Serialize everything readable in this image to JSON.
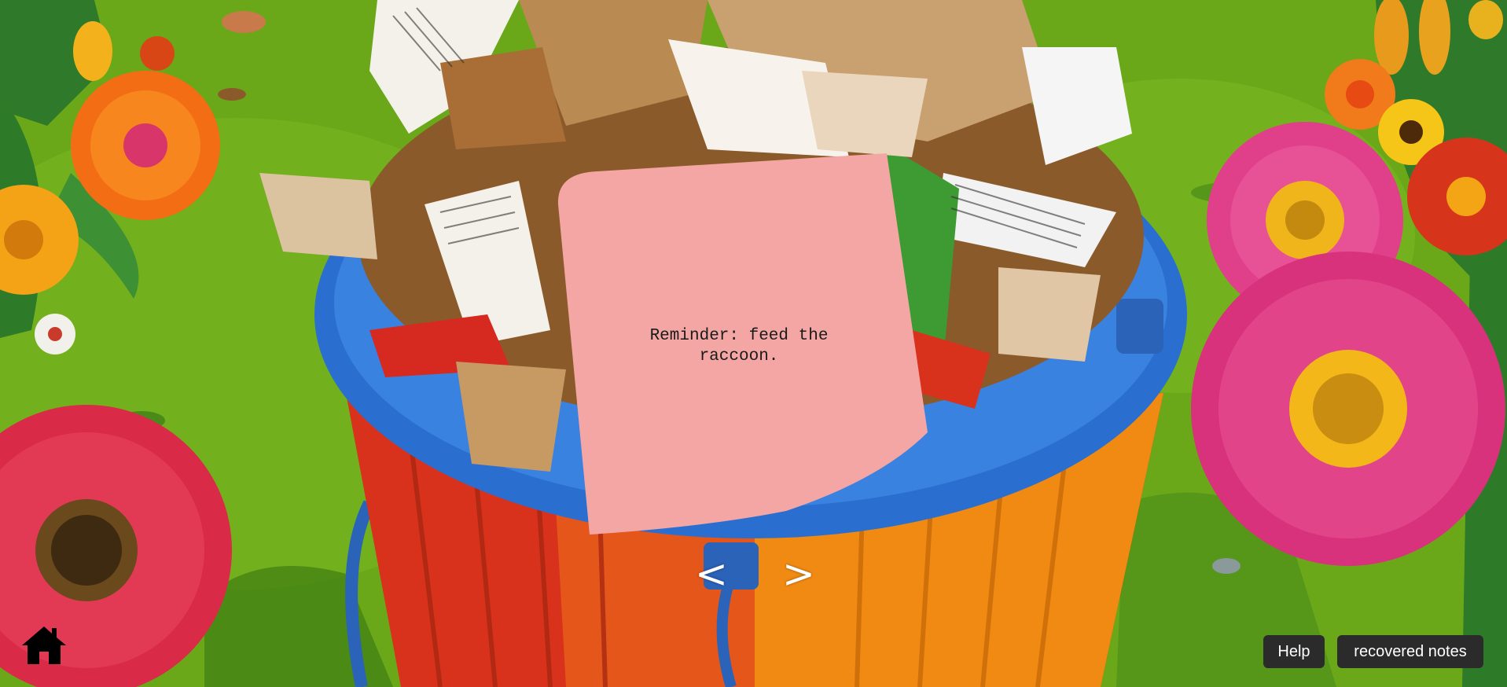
{
  "note": {
    "text": "Reminder: feed the raccoon.",
    "color": "#f4a6a4"
  },
  "navigation": {
    "prev_label": "<",
    "next_label": ">"
  },
  "buttons": {
    "help_label": "Help",
    "recovered_notes_label": "recovered notes"
  },
  "icons": {
    "home": "home-icon"
  },
  "colors": {
    "grass": "#6aa81a",
    "bin_lid": "#2a6fcf",
    "bin_body_red": "#d8321c",
    "bin_body_orange": "#f08a12",
    "button_bg": "#2b2b2b"
  }
}
